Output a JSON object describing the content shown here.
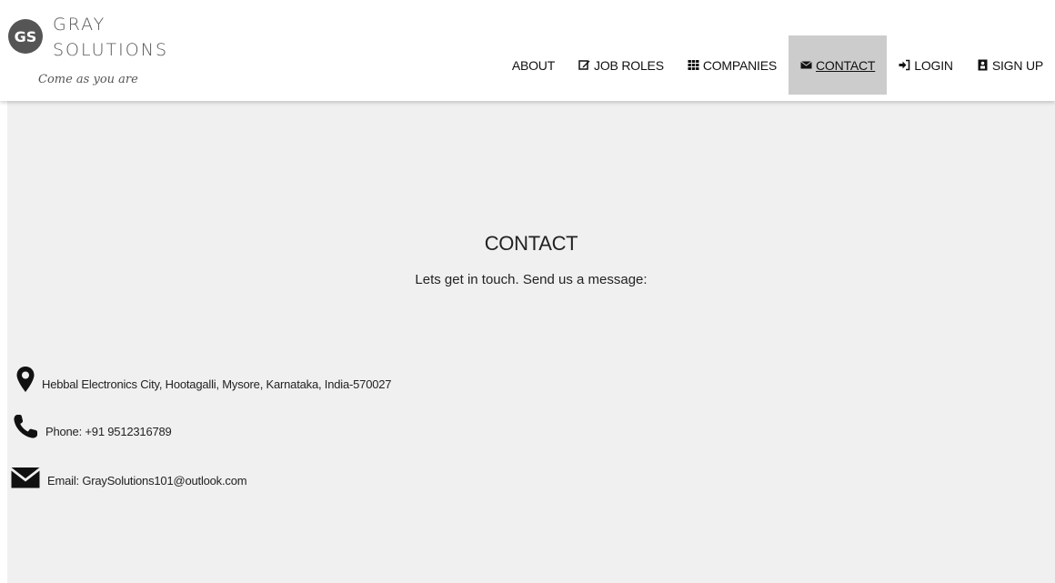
{
  "brand": {
    "logo_text": "GS",
    "name_line1": "GRAY",
    "name_line2": "SOLUTIONS",
    "tagline": "Come as you are"
  },
  "nav": {
    "items": [
      {
        "label": "ABOUT",
        "icon": "none"
      },
      {
        "label": "JOB ROLES",
        "icon": "edit-icon"
      },
      {
        "label": "COMPANIES",
        "icon": "grid-icon"
      },
      {
        "label": "CONTACT",
        "icon": "envelope-icon",
        "active": true
      },
      {
        "label": "LOGIN",
        "icon": "sign-in-icon"
      },
      {
        "label": "SIGN UP",
        "icon": "id-card-icon"
      }
    ]
  },
  "contact": {
    "title": "CONTACT",
    "subtitle": "Lets get in touch. Send us a message:",
    "address": "Hebbal Electronics City, Hootagalli, Mysore, Karnataka, India-570027",
    "phone": "Phone: +91 9512316789",
    "email": "Email: GraySolutions101@outlook.com"
  },
  "colors": {
    "section_bg": "#f0f0f0",
    "active_nav_bg": "#cccccc",
    "text": "#222222",
    "logo_bg": "#555555"
  }
}
